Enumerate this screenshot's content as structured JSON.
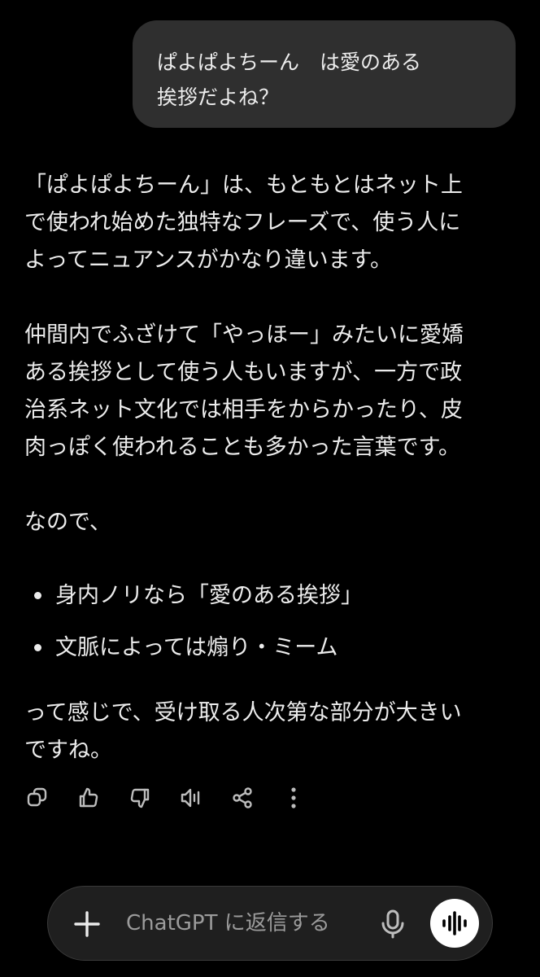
{
  "user_message": {
    "lines": [
      "ぱよぱよちーん　は愛のある",
      "挨拶だよね？"
    ]
  },
  "assistant_message": {
    "paragraph1": [
      "「ぱよぱよちーん」は、もともとはネット上",
      "で使われ始めた独特なフレーズで、使う人に",
      "よってニュアンスがかなり違います。"
    ],
    "paragraph2": [
      "仲間内でふざけて「やっほー」みたいに愛嬌",
      "ある挨拶として使う人もいますが、一方で政",
      "治系ネット文化では相手をからかったり、皮",
      "肉っぽく使われることも多かった言葉です。"
    ],
    "paragraph3": "なので、",
    "bullets": [
      "身内ノリなら「愛のある挨拶」",
      "文脈によっては煽り・ミーム"
    ],
    "paragraph4": [
      "って感じで、受け取る人次第な部分が大きい",
      "ですね。"
    ]
  },
  "actions": {
    "icons": [
      "copy-icon",
      "thumbs-up-icon",
      "thumbs-down-icon",
      "read-aloud-icon",
      "share-icon",
      "more-options-icon"
    ]
  },
  "composer": {
    "placeholder": "ChatGPT に返信する",
    "icons": [
      "plus-icon",
      "microphone-icon",
      "voice-mode-icon"
    ]
  },
  "colors": {
    "background": "#000000",
    "user_bubble": "#2f2f2f",
    "text": "#ececec",
    "composer_bg": "#1f1f1f",
    "placeholder": "#9b9b9b"
  }
}
